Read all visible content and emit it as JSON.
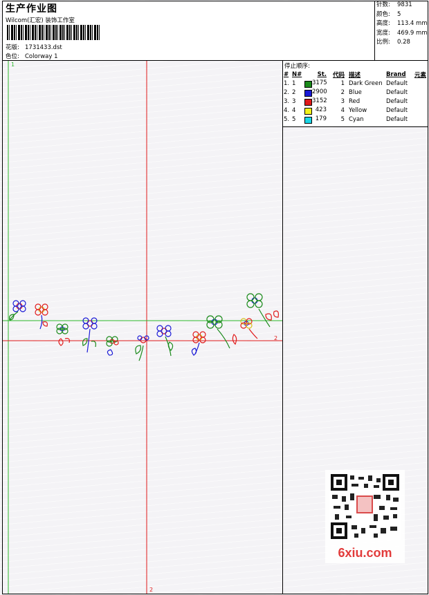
{
  "header": {
    "title": "生产作业图",
    "studio": "Wilcom(汇宏) 装饰工作室",
    "design_label": "花版:",
    "design_file": "1731433.dst",
    "colorway_label": "色位:",
    "colorway": "Colorway 1"
  },
  "stats": [
    {
      "label": "针数:",
      "value": "9831"
    },
    {
      "label": "颜色:",
      "value": "5"
    },
    {
      "label": "高度:",
      "value": "113.4 mm"
    },
    {
      "label": "宽度:",
      "value": "469.9 mm"
    },
    {
      "label": "比例:",
      "value": "0.28"
    }
  ],
  "legend": {
    "title": "停止顺序:",
    "headers": [
      "#",
      "N#",
      "St.",
      "代码",
      "描述",
      "Brand",
      "元素"
    ],
    "rows": [
      {
        "n": "1.",
        "nn": "1",
        "color": "#1a8a1a",
        "st": "3175",
        "code": "1",
        "desc": "Dark Green",
        "brand": "Default"
      },
      {
        "n": "2.",
        "nn": "2",
        "color": "#1919d6",
        "st": "2900",
        "code": "2",
        "desc": "Blue",
        "brand": "Default"
      },
      {
        "n": "3.",
        "nn": "3",
        "color": "#e01a1a",
        "st": "3152",
        "code": "3",
        "desc": "Red",
        "brand": "Default"
      },
      {
        "n": "4.",
        "nn": "4",
        "color": "#f2f21a",
        "st": "423",
        "code": "4",
        "desc": "Yellow",
        "brand": "Default"
      },
      {
        "n": "5.",
        "nn": "5",
        "color": "#1ad6e6",
        "st": "179",
        "code": "5",
        "desc": "Cyan",
        "brand": "Default"
      }
    ]
  },
  "guides": {
    "vline_label": "1",
    "hline_label": "2",
    "vline2_label": "2"
  },
  "watermark": {
    "brand": "6xiu.com"
  }
}
